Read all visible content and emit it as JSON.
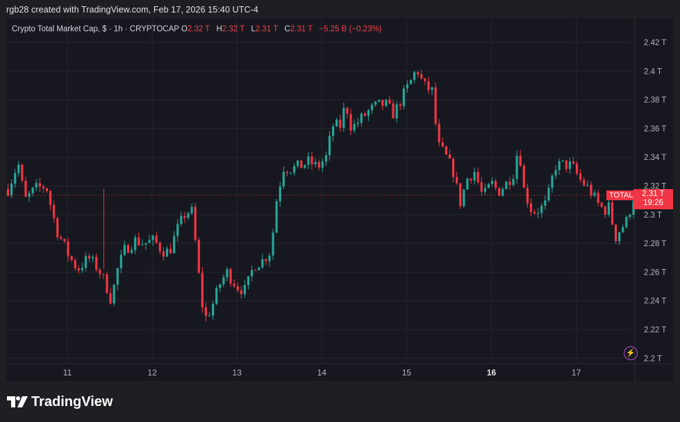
{
  "header": {
    "caption": "rgb28 created with TradingView.com, Feb 17, 2026 15:40 UTC-4"
  },
  "legend": {
    "title": "Crypto Total Market Cap, $ · 1h · CRYPTOCAP",
    "open_label": "O",
    "open_value": "2.32 T",
    "high_label": "H",
    "high_value": "2.32 T",
    "low_label": "L",
    "low_value": "2.31 T",
    "close_label": "C",
    "close_value": "2.31 T",
    "change": "−5.25 B (−0.23%)"
  },
  "price_tag": {
    "symbol": "TOTAL",
    "price": "2.31 T",
    "countdown": "19:26"
  },
  "brand": {
    "name": "TradingView",
    "logo_icon": "tradingview-logo-icon"
  },
  "colors": {
    "up": "#26a69a",
    "down": "#f23645",
    "background": "#17181f",
    "grid": "#26272e",
    "text": "#b2b5be"
  },
  "chart_data": {
    "type": "candlestick",
    "symbol": "TOTAL",
    "interval": "1h",
    "x_tick_labels": [
      "11",
      "12",
      "13",
      "14",
      "15",
      "16",
      "17"
    ],
    "x_tick_bold": [
      false,
      false,
      false,
      false,
      false,
      true,
      false
    ],
    "y_tick_labels": [
      "2.42 T",
      "2.4 T",
      "2.38 T",
      "2.36 T",
      "2.34 T",
      "2.32 T",
      "2.3 T",
      "2.28 T",
      "2.26 T",
      "2.24 T",
      "2.22 T",
      "2.2 T"
    ],
    "y_tick_values": [
      2.42,
      2.4,
      2.38,
      2.36,
      2.34,
      2.32,
      2.3,
      2.28,
      2.26,
      2.24,
      2.22,
      2.2
    ],
    "ylim": [
      2.19,
      2.43
    ],
    "current_price": 2.3135,
    "grid": true,
    "unit": "T",
    "close_path": [
      [
        10.3,
        2.318
      ],
      [
        10.42,
        2.336
      ],
      [
        10.5,
        2.31
      ],
      [
        10.62,
        2.318
      ],
      [
        10.75,
        2.32
      ],
      [
        10.87,
        2.29
      ],
      [
        11.02,
        2.271
      ],
      [
        11.12,
        2.262
      ],
      [
        11.25,
        2.27
      ],
      [
        11.37,
        2.262
      ],
      [
        11.45,
        2.252
      ],
      [
        11.52,
        2.24
      ],
      [
        11.58,
        2.26
      ],
      [
        11.68,
        2.276
      ],
      [
        11.8,
        2.282
      ],
      [
        11.9,
        2.28
      ],
      [
        12.02,
        2.282
      ],
      [
        12.12,
        2.275
      ],
      [
        12.2,
        2.274
      ],
      [
        12.3,
        2.29
      ],
      [
        12.4,
        2.302
      ],
      [
        12.47,
        2.302
      ],
      [
        12.52,
        2.275
      ],
      [
        12.58,
        2.24
      ],
      [
        12.63,
        2.228
      ],
      [
        12.7,
        2.235
      ],
      [
        12.8,
        2.252
      ],
      [
        12.88,
        2.26
      ],
      [
        13.0,
        2.25
      ],
      [
        13.1,
        2.247
      ],
      [
        13.2,
        2.265
      ],
      [
        13.3,
        2.268
      ],
      [
        13.4,
        2.275
      ],
      [
        13.47,
        2.312
      ],
      [
        13.55,
        2.333
      ],
      [
        13.65,
        2.332
      ],
      [
        13.75,
        2.334
      ],
      [
        13.85,
        2.337
      ],
      [
        13.95,
        2.333
      ],
      [
        14.05,
        2.34
      ],
      [
        14.13,
        2.362
      ],
      [
        14.22,
        2.362
      ],
      [
        14.28,
        2.378
      ],
      [
        14.35,
        2.36
      ],
      [
        14.45,
        2.366
      ],
      [
        14.55,
        2.372
      ],
      [
        14.65,
        2.376
      ],
      [
        14.75,
        2.377
      ],
      [
        14.85,
        2.37
      ],
      [
        14.95,
        2.382
      ],
      [
        15.05,
        2.393
      ],
      [
        15.12,
        2.402
      ],
      [
        15.2,
        2.39
      ],
      [
        15.3,
        2.386
      ],
      [
        15.37,
        2.348
      ],
      [
        15.45,
        2.342
      ],
      [
        15.55,
        2.33
      ],
      [
        15.63,
        2.308
      ],
      [
        15.72,
        2.326
      ],
      [
        15.8,
        2.33
      ],
      [
        15.9,
        2.312
      ],
      [
        16.0,
        2.322
      ],
      [
        16.08,
        2.316
      ],
      [
        16.18,
        2.322
      ],
      [
        16.27,
        2.33
      ],
      [
        16.32,
        2.35
      ],
      [
        16.38,
        2.318
      ],
      [
        16.48,
        2.302
      ],
      [
        16.58,
        2.304
      ],
      [
        16.65,
        2.308
      ],
      [
        16.75,
        2.334
      ],
      [
        16.85,
        2.335
      ],
      [
        16.95,
        2.334
      ],
      [
        17.05,
        2.324
      ],
      [
        17.15,
        2.318
      ],
      [
        17.25,
        2.308
      ],
      [
        17.33,
        2.303
      ],
      [
        17.4,
        2.306
      ],
      [
        17.45,
        2.283
      ],
      [
        17.52,
        2.29
      ],
      [
        17.6,
        2.296
      ],
      [
        17.68,
        2.3135
      ]
    ]
  }
}
